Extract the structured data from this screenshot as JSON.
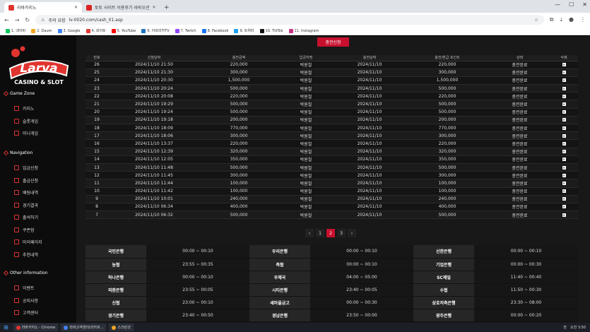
{
  "browser": {
    "tabs": [
      {
        "title": "라바카지노",
        "active": true,
        "fav_color": "#e0342f"
      },
      {
        "title": "토토 사이트 이용후기 라바오션",
        "active": false,
        "fav_color": "#d22"
      }
    ],
    "url": "lv-0020.com/cash_01.asp",
    "security_label": "주의 요함",
    "bookmarks": [
      {
        "label": "1. 네이버",
        "color": "#03c75a"
      },
      {
        "label": "2. Daum",
        "color": "#f5a623"
      },
      {
        "label": "3. Google",
        "color": "#4285f4"
      },
      {
        "label": "4. 네이트",
        "color": "#e53935"
      },
      {
        "label": "5. YouTube",
        "color": "#ff0000"
      },
      {
        "label": "6. 아프리카TV",
        "color": "#1e73be"
      },
      {
        "label": "7. Twitch",
        "color": "#9146ff"
      },
      {
        "label": "8. Facebook",
        "color": "#1877f2"
      },
      {
        "label": "9. 트위터",
        "color": "#1da1f2"
      },
      {
        "label": "10. TikTok",
        "color": "#111111"
      },
      {
        "label": "11. Instagram",
        "color": "#c13584"
      }
    ]
  },
  "sidebar": {
    "brand": "Larva",
    "brand_sub": "CASINO & SLOT",
    "sections": [
      {
        "title": "Game Zone",
        "items": [
          "카지노",
          "슬롯게임",
          "미니게임"
        ]
      },
      {
        "title": "Navigation",
        "items": [
          "입금신청",
          "출금신청",
          "배팅내역",
          "경기결과",
          "출석하기",
          "쿠폰함",
          "마이페이지",
          "추천내역"
        ]
      },
      {
        "title": "Other information",
        "items": [
          "이벤트",
          "공지사항",
          "고객센터"
        ]
      }
    ]
  },
  "main": {
    "charge_button": "충전신청",
    "columns": [
      "번호",
      "신청날짜",
      "충전금액",
      "입금자명",
      "충전날짜",
      "충전/환급 포인트",
      "상태",
      "삭제"
    ],
    "rows": [
      [
        "26",
        "2024/11/10 21:50",
        "220,000",
        "박원철",
        "2024/11/10",
        "220,000",
        "충전완료"
      ],
      [
        "25",
        "2024/11/10 21:30",
        "300,000",
        "박원철",
        "2024/11/10",
        "300,000",
        "충전완료"
      ],
      [
        "24",
        "2024/11/10 20:30",
        "1,500,000",
        "박원철",
        "2024/11/10",
        "1,500,000",
        "충전완료"
      ],
      [
        "23",
        "2024/11/10 20:24",
        "500,000",
        "박원철",
        "2024/11/10",
        "500,000",
        "충전완료"
      ],
      [
        "22",
        "2024/11/10 20:08",
        "220,000",
        "박원철",
        "2024/11/10",
        "220,000",
        "충전완료"
      ],
      [
        "21",
        "2024/11/10 19:29",
        "500,000",
        "박원철",
        "2024/11/10",
        "500,000",
        "충전완료"
      ],
      [
        "20",
        "2024/11/10 19:24",
        "500,000",
        "박원철",
        "2024/11/10",
        "500,000",
        "충전완료"
      ],
      [
        "19",
        "2024/11/10 19:18",
        "200,000",
        "박원철",
        "2024/11/10",
        "200,000",
        "충전완료"
      ],
      [
        "18",
        "2024/11/10 18:09",
        "770,000",
        "박원철",
        "2024/11/10",
        "770,000",
        "충전완료"
      ],
      [
        "17",
        "2024/11/10 18:06",
        "300,000",
        "박원철",
        "2024/11/10",
        "300,000",
        "충전완료"
      ],
      [
        "16",
        "2024/11/10 13:37",
        "220,000",
        "박원철",
        "2024/11/10",
        "220,000",
        "충전완료"
      ],
      [
        "15",
        "2024/11/10 12:39",
        "320,000",
        "박원철",
        "2024/11/10",
        "320,000",
        "충전완료"
      ],
      [
        "14",
        "2024/11/10 12:05",
        "350,000",
        "박원철",
        "2024/11/10",
        "350,000",
        "충전완료"
      ],
      [
        "13",
        "2024/11/10 11:48",
        "500,000",
        "박원철",
        "2024/11/10",
        "500,000",
        "충전완료"
      ],
      [
        "12",
        "2024/11/10 11:45",
        "300,000",
        "박원철",
        "2024/11/10",
        "300,000",
        "충전완료"
      ],
      [
        "11",
        "2024/11/10 11:44",
        "100,000",
        "박원철",
        "2024/11/10",
        "100,000",
        "충전완료"
      ],
      [
        "10",
        "2024/11/10 11:42",
        "100,000",
        "박원철",
        "2024/11/10",
        "100,000",
        "충전완료"
      ],
      [
        "9",
        "2024/11/10 10:01",
        "240,000",
        "박원철",
        "2024/11/10",
        "240,000",
        "충전완료"
      ],
      [
        "8",
        "2024/11/10 06:34",
        "400,000",
        "박원철",
        "2024/11/10",
        "400,000",
        "충전완료"
      ],
      [
        "7",
        "2024/11/10 06:32",
        "500,000",
        "박원철",
        "2024/11/10",
        "500,000",
        "충전완료"
      ]
    ],
    "delete_glyph": "✕",
    "pagination": {
      "prev": "‹",
      "next": "›",
      "pages": [
        "1",
        "2",
        "3"
      ],
      "current": "2"
    },
    "bank_hours": [
      [
        "국민은행",
        "00:00 ~ 00:10",
        "우리은행",
        "00:00 ~ 00:10",
        "신한은행",
        "00:00 ~ 00:10"
      ],
      [
        "농협",
        "23:55 ~ 00:35",
        "축협",
        "00:00 ~ 00:10",
        "기업은행",
        "00:00 ~ 00:30"
      ],
      [
        "하나은행",
        "00:00 ~ 00:10",
        "우체국",
        "04:00 ~ 05:00",
        "SC제일",
        "11:40 ~ 00:40"
      ],
      [
        "외환은행",
        "23:55 ~ 00:05",
        "시티은행",
        "23:40 ~ 00:05",
        "수협",
        "11:50 ~ 00:30"
      ],
      [
        "신협",
        "23:00 ~ 00:10",
        "새마을금고",
        "00:00 ~ 00:30",
        "상호저축은행",
        "23:30 ~ 08:00"
      ],
      [
        "경기은행",
        "23:40 ~ 00:50",
        "경남은행",
        "23:50 ~ 00:00",
        "광주은행",
        "00:00 ~ 00:20"
      ]
    ]
  },
  "taskbar": {
    "items": [
      {
        "label": "라바카지노 - Chrome",
        "color": "#e0342f"
      },
      {
        "label": "라바고객센터(라카르...",
        "color": "#4285f4"
      },
      {
        "label": "스크린샷",
        "color": "#f5a623"
      }
    ],
    "lang": "한",
    "clock": "오전 3:50"
  },
  "colors": {
    "accent": "#c8102e"
  }
}
